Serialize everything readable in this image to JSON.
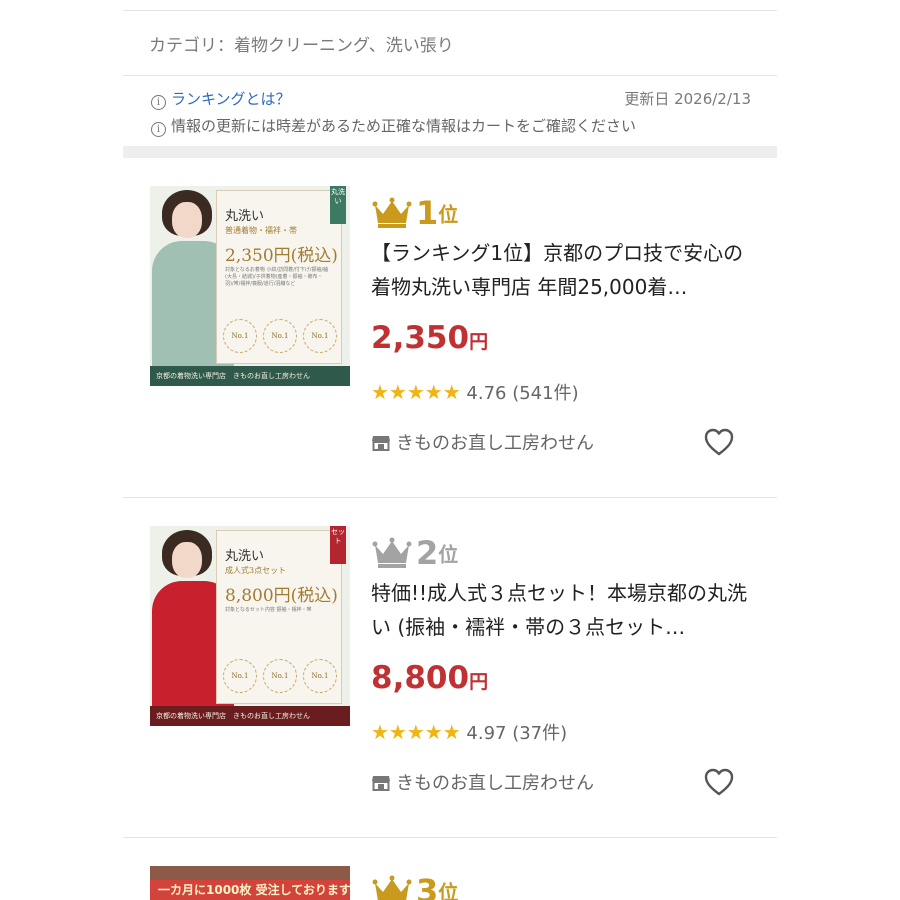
{
  "header": {
    "category": "カテゴリ：着物クリーニング、洗い張り",
    "ranking_link": "ランキングとは？",
    "update_date": "更新日 2026/2/13",
    "notice": "情報の更新には時差があるため正確な情報はカートをご確認ください"
  },
  "colors": {
    "gold": "#c99a1c",
    "silver": "#a3a3a3",
    "price_red": "#bf3132",
    "star": "#f0b413",
    "link_blue": "#2d6bc4"
  },
  "items": [
    {
      "rank_num": "1",
      "rank_unit": "位",
      "crown_color": "gold",
      "title": "【ランキング1位】京都のプロ技で安心の着物丸洗い専門店 年間25,000着…",
      "price_num": "2,350",
      "price_unit": "円",
      "stars": "★★★★★",
      "rating": "4.76",
      "review_count": "(541件)",
      "shop": "きものお直し工房わせん",
      "thumb": {
        "tag": "丸洗い",
        "card_title": "丸洗い",
        "card_sub": "普通着物・襦袢・帯",
        "card_price": "2,350円(税込)",
        "card_small": "対象となるお着物 小紋/訪問着/付下げ/振袖/紬(大島・結城)/子供着物(産着・振袖・被布・羽)/帯/襦袢/喪服/道行/羽織など",
        "badge": "No.1",
        "footer": "京都の着物洗い専門店　きものお直し工房わせん"
      }
    },
    {
      "rank_num": "2",
      "rank_unit": "位",
      "crown_color": "silver",
      "title": "特価!!成人式３点セット！本場京都の丸洗い (振袖・襦袢・帯の３点セット…",
      "price_num": "8,800",
      "price_unit": "円",
      "stars": "★★★★★",
      "rating": "4.97",
      "review_count": "(37件)",
      "shop": "きものお直し工房わせん",
      "thumb": {
        "tag": "セット",
        "card_title": "丸洗い",
        "card_sub": "成人式3点セット",
        "card_price": "8,800円(税込)",
        "card_small": "対象となるセット内容 振袖・襦袢・帯",
        "badge": "No.1",
        "footer": "京都の着物洗い専門店　きものお直し工房わせん"
      }
    },
    {
      "rank_num": "3",
      "rank_unit": "位",
      "crown_color": "gold",
      "thumb": {
        "banner": "一カ月に1000枚 受注しております!"
      }
    }
  ]
}
